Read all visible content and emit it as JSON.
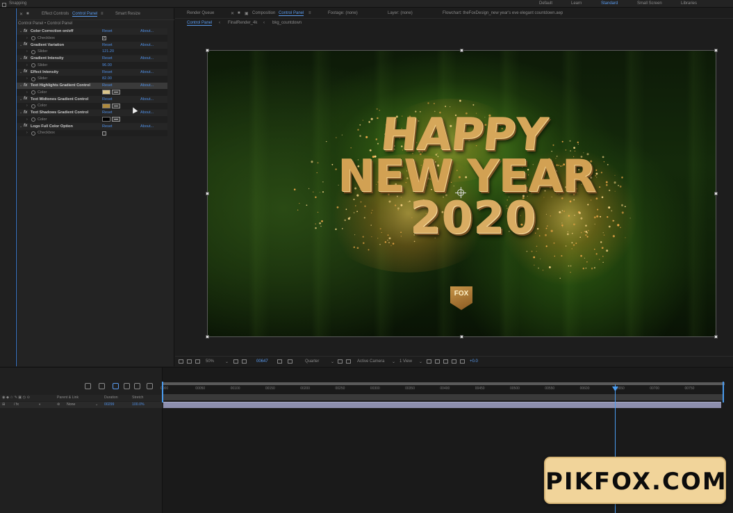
{
  "topbar": {
    "snapping": "Snapping",
    "workspaces": [
      "Default",
      "Learn",
      "Standard",
      "Small Screen",
      "Libraries"
    ],
    "active_workspace": "Standard"
  },
  "effect_controls": {
    "tab_prefix": "Effect Controls",
    "tab_active": "Control Panel",
    "tab_other": "Smart Resize",
    "subtitle": "Control Panel • Control Panel",
    "rows": [
      {
        "kind": "main",
        "name": "Color Correction on/off",
        "reset": "Reset",
        "about": "About..."
      },
      {
        "kind": "sub",
        "name": "Checkbox",
        "value": "✓",
        "control": "checkbox"
      },
      {
        "kind": "main",
        "name": "Gradient Variation",
        "reset": "Reset",
        "about": "About..."
      },
      {
        "kind": "sub",
        "name": "Slider",
        "value": "121.20",
        "control": "slider"
      },
      {
        "kind": "main",
        "name": "Gradient Intensity",
        "reset": "Reset",
        "about": "About..."
      },
      {
        "kind": "sub",
        "name": "Slider",
        "value": "96.00",
        "control": "slider"
      },
      {
        "kind": "main",
        "name": "Effect Intensity",
        "reset": "Reset",
        "about": "About..."
      },
      {
        "kind": "sub",
        "name": "Slider",
        "value": "82.00",
        "control": "slider"
      },
      {
        "kind": "main",
        "name": "Text Highlights Gradient Control",
        "reset": "Reset",
        "about": "About...",
        "highlight": true
      },
      {
        "kind": "sub",
        "name": "Color",
        "control": "color",
        "color": "#d9c48a"
      },
      {
        "kind": "main",
        "name": "Text Midtones Gradient Control",
        "reset": "Reset",
        "about": "About..."
      },
      {
        "kind": "sub",
        "name": "Color",
        "control": "color",
        "color": "#b08a3c"
      },
      {
        "kind": "main",
        "name": "Text Shadows Gradient Control",
        "reset": "Reset",
        "about": "About..."
      },
      {
        "kind": "sub",
        "name": "Color",
        "control": "color",
        "color": "#000000"
      },
      {
        "kind": "main",
        "name": "Logo Full Color Option",
        "reset": "Reset",
        "about": "About..."
      },
      {
        "kind": "sub",
        "name": "Checkbox",
        "value": "",
        "control": "checkbox"
      }
    ]
  },
  "composition": {
    "tabs": {
      "render_queue": "Render Queue",
      "comp_prefix": "Composition",
      "comp_active": "Control Panel",
      "footage": "Footage: (none)",
      "layer": "Layer: (none)",
      "project_file": "Flowchart: theFoxDesign_new year's eve elegant countdown.aep"
    },
    "crumbs": [
      "Control Panel",
      "FinalRender_4k",
      "bkg_countdown"
    ],
    "preview": {
      "line1": "HAPPY",
      "line2": "NEW YEAR",
      "line3": "2020",
      "logo": "FOX"
    },
    "bottom": {
      "zoom": "50%",
      "timecode": "00647",
      "resolution": "Quarter",
      "camera": "Active Camera",
      "view": "1 View",
      "exposure": "+0.0"
    }
  },
  "timeline": {
    "headers": {
      "parent": "Parent & Link",
      "duration": "Duration",
      "stretch": "Stretch"
    },
    "layer": {
      "parent_value": "None",
      "duration": "00299",
      "stretch": "100.0%"
    },
    "ticks": [
      "0000",
      "00050",
      "00100",
      "00150",
      "00200",
      "00250",
      "00300",
      "00350",
      "00400",
      "00450",
      "00500",
      "00550",
      "00600",
      "00650",
      "00700",
      "00750"
    ]
  },
  "watermark": {
    "text": "PIKFOX.COM"
  }
}
